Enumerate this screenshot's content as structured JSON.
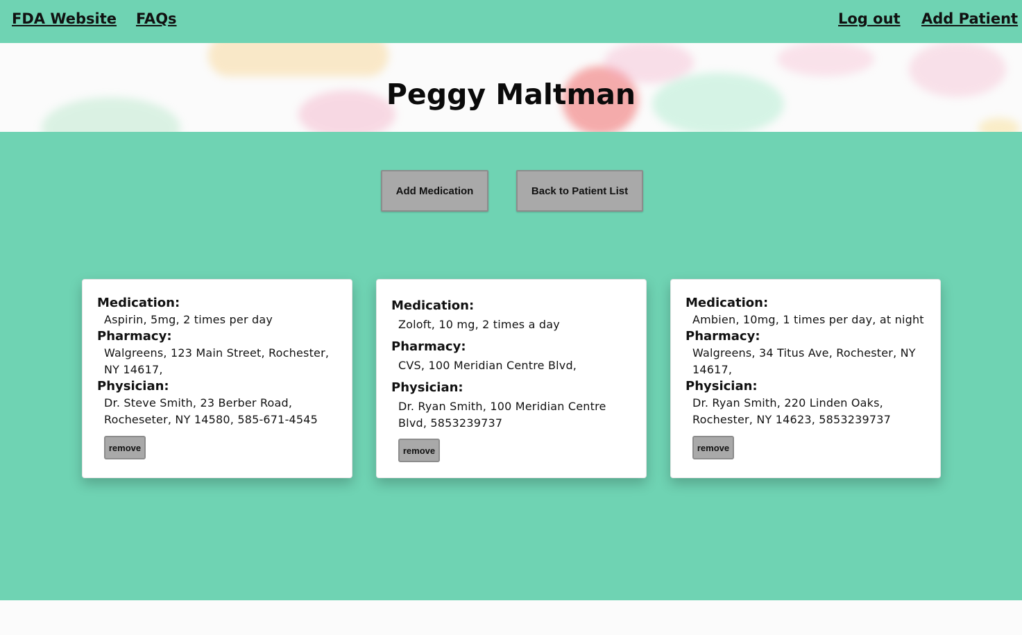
{
  "nav": {
    "fda": "FDA Website",
    "faqs": "FAQs",
    "logout": "Log out",
    "add_patient": "Add Patient"
  },
  "patient": {
    "name": "Peggy Maltman"
  },
  "actions": {
    "add_medication": "Add Medication",
    "back": "Back to Patient List"
  },
  "cards": [
    {
      "medication_label": "Medication:",
      "medication": "Aspirin, 5mg, 2 times per day",
      "pharmacy_label": "Pharmacy:",
      "pharmacy": "Walgreens, 123 Main Street, Rochester, NY 14617,",
      "physician_label": "Physician:",
      "physician": "Dr. Steve Smith, 23 Berber Road, Rocheseter, NY 14580, 585-671-4545",
      "remove": "remove"
    },
    {
      "medication_label": "Medication:",
      "medication": "Zoloft, 10 mg, 2 times a day",
      "pharmacy_label": "Pharmacy:",
      "pharmacy": "CVS, 100 Meridian Centre Blvd,",
      "physician_label": "Physician:",
      "physician": "Dr. Ryan Smith, 100 Meridian Centre Blvd, 5853239737",
      "remove": "remove"
    },
    {
      "medication_label": "Medication:",
      "medication": "Ambien, 10mg, 1 times per day, at night",
      "pharmacy_label": "Pharmacy:",
      "pharmacy": "Walgreens, 34 Titus Ave, Rochester, NY 14617,",
      "physician_label": "Physician:",
      "physician": "Dr. Ryan Smith, 220 Linden Oaks, Rochester, NY 14623, 5853239737",
      "remove": "remove"
    }
  ],
  "colors": {
    "accent": "#6fd3b3",
    "button": "#a9a9a9",
    "card": "#ffffff"
  }
}
